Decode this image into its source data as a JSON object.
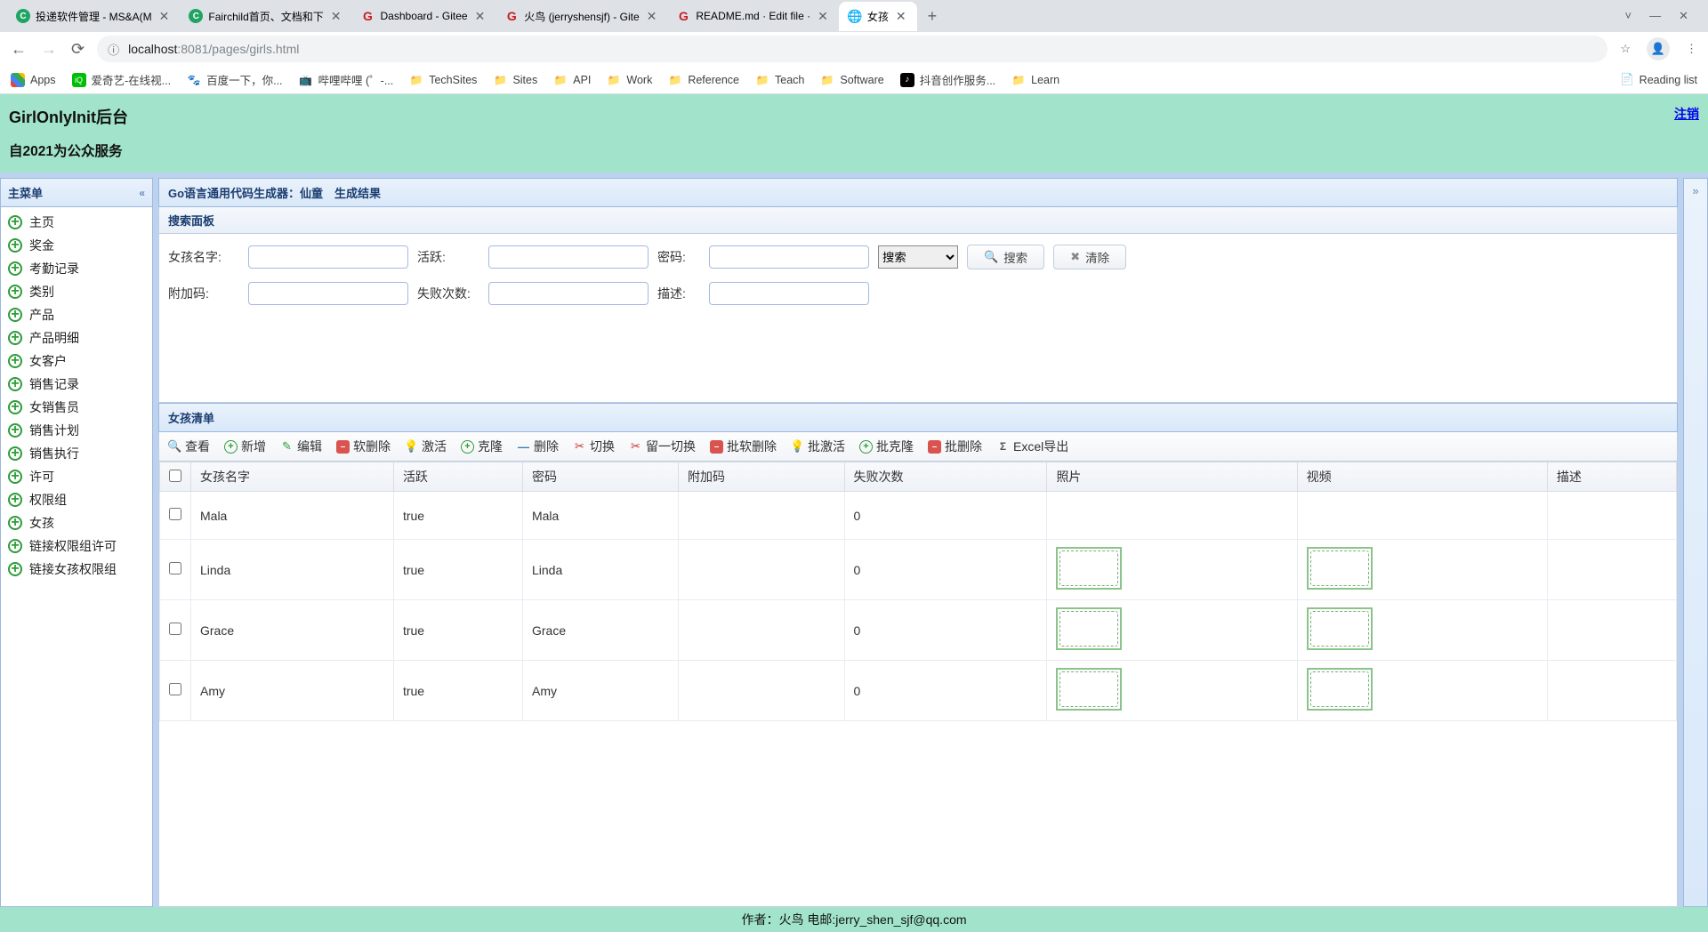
{
  "browser": {
    "tabs": [
      {
        "title": "投递软件管理 - MS&A(M",
        "favicon": "green-c"
      },
      {
        "title": "Fairchild首页、文档和下",
        "favicon": "green-c"
      },
      {
        "title": "Dashboard - Gitee",
        "favicon": "red-g"
      },
      {
        "title": "火鸟 (jerryshensjf) - Gite",
        "favicon": "red-g"
      },
      {
        "title": "README.md · Edit file · ",
        "favicon": "red-g"
      },
      {
        "title": "女孩",
        "favicon": "globe",
        "active": true
      }
    ],
    "url_prefix": "localhost",
    "url_path": ":8081/pages/girls.html",
    "bookmarks": [
      {
        "label": "Apps",
        "icon": "apps"
      },
      {
        "label": "爱奇艺-在线视...",
        "icon": "iqiyi"
      },
      {
        "label": "百度一下，你...",
        "icon": "baidu"
      },
      {
        "label": "哔哩哔哩 (゜-...",
        "icon": "bili"
      },
      {
        "label": "TechSites",
        "icon": "folder"
      },
      {
        "label": "Sites",
        "icon": "folder"
      },
      {
        "label": "API",
        "icon": "folder"
      },
      {
        "label": "Work",
        "icon": "folder"
      },
      {
        "label": "Reference",
        "icon": "folder"
      },
      {
        "label": "Teach",
        "icon": "folder"
      },
      {
        "label": "Software",
        "icon": "folder"
      },
      {
        "label": "抖音创作服务...",
        "icon": "douyin"
      },
      {
        "label": "Learn",
        "icon": "folder"
      }
    ],
    "reading_list": "Reading list"
  },
  "header": {
    "title": "GirlOnlyInit后台",
    "subtitle": "自2021为公众服务",
    "logout": "注销"
  },
  "sidebar": {
    "panel_title": "主菜单",
    "items": [
      "主页",
      "奖金",
      "考勤记录",
      "类别",
      "产品",
      "产品明细",
      "女客户",
      "销售记录",
      "女销售员",
      "销售计划",
      "销售执行",
      "许可",
      "权限组",
      "女孩",
      "链接权限组许可",
      "链接女孩权限组"
    ]
  },
  "main": {
    "breadcrumb": "Go语言通用代码生成器：仙童　生成结果",
    "search_panel_title": "搜索面板",
    "search_fields": {
      "girl_name": "女孩名字:",
      "active": "活跃:",
      "password": "密码:",
      "extra_code": "附加码:",
      "fail_count": "失败次数:",
      "description": "描述:"
    },
    "search_dropdown": "搜索",
    "search_btn": "搜索",
    "clear_btn": "清除",
    "list_title": "女孩清单",
    "toolbar": {
      "view": "查看",
      "add": "新增",
      "edit": "编辑",
      "softdel": "软删除",
      "activate": "激活",
      "clone": "克隆",
      "delete": "删除",
      "toggle": "切换",
      "leave_toggle": "留一切换",
      "batch_softdel": "批软删除",
      "batch_activate": "批激活",
      "batch_clone": "批克隆",
      "batch_delete": "批删除",
      "excel": "Excel导出"
    },
    "columns": [
      "",
      "女孩名字",
      "活跃",
      "密码",
      "附加码",
      "失败次数",
      "照片",
      "视频",
      "描述"
    ],
    "rows": [
      {
        "name": "Mala",
        "active": "true",
        "pwd": "Mala",
        "extra": "",
        "fail": "0",
        "p": "p1",
        "v": "v1"
      },
      {
        "name": "Linda",
        "active": "true",
        "pwd": "Linda",
        "extra": "",
        "fail": "0",
        "p": "vine",
        "v": "vine"
      },
      {
        "name": "Grace",
        "active": "true",
        "pwd": "Grace",
        "extra": "",
        "fail": "0",
        "p": "vine",
        "v": "vine"
      },
      {
        "name": "Amy",
        "active": "true",
        "pwd": "Amy",
        "extra": "",
        "fail": "0",
        "p": "vine",
        "v": "vine"
      }
    ]
  },
  "footer": "作者：火鸟 电邮:jerry_shen_sjf@qq.com"
}
